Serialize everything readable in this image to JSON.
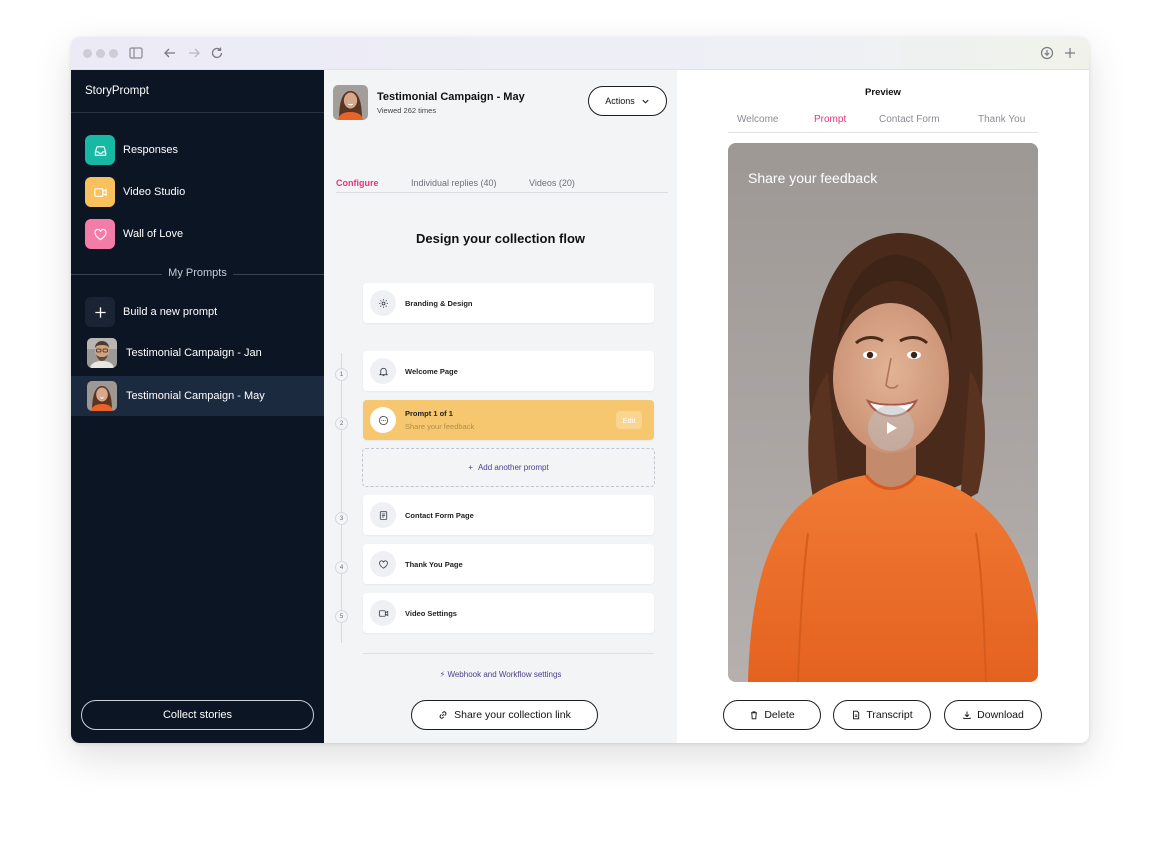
{
  "app": {
    "brand": "StoryPrompt"
  },
  "sidebar": {
    "nav": [
      {
        "label": "Responses",
        "icon": "inbox-icon",
        "color": "#17b8a4"
      },
      {
        "label": "Video Studio",
        "icon": "video-icon",
        "color": "#f8c15e"
      },
      {
        "label": "Wall of Love",
        "icon": "heart-icon",
        "color": "#f47da8"
      }
    ],
    "section_label": "My Prompts",
    "build_label": "Build a new prompt",
    "campaigns": [
      {
        "label": "Testimonial Campaign - Jan"
      },
      {
        "label": "Testimonial Campaign - May"
      }
    ],
    "collect_label": "Collect stories"
  },
  "campaign": {
    "title": "Testimonial Campaign - May",
    "views": "Viewed 262 times",
    "actions_label": "Actions"
  },
  "tabs": [
    {
      "label": "Configure"
    },
    {
      "label": "Individual replies (40)"
    },
    {
      "label": "Videos (20)"
    }
  ],
  "flow": {
    "title": "Design your collection flow",
    "branding": "Branding & Design",
    "steps": [
      {
        "num": "1",
        "label": "Welcome Page"
      },
      {
        "num": "2",
        "label": "Prompt 1 of 1",
        "sub": "Share your feedback",
        "edit": "Edit"
      },
      {
        "num": "3",
        "label": "Contact Form Page"
      },
      {
        "num": "4",
        "label": "Thank You Page"
      },
      {
        "num": "5",
        "label": "Video Settings"
      }
    ],
    "add_prompt": "Add another prompt",
    "webhook": "Webhook and Workflow settings",
    "share_label": "Share your collection link"
  },
  "preview": {
    "title": "Preview",
    "tabs": [
      "Welcome",
      "Prompt",
      "Contact Form",
      "Thank You"
    ],
    "caption": "Share your feedback",
    "delete_label": "Delete",
    "transcript_label": "Transcript",
    "download_label": "Download"
  },
  "colors": {
    "accent": "#e6357a",
    "active_step": "#f6c76e",
    "sidebar_bg": "#0c1523",
    "link": "#4b3e8a"
  }
}
